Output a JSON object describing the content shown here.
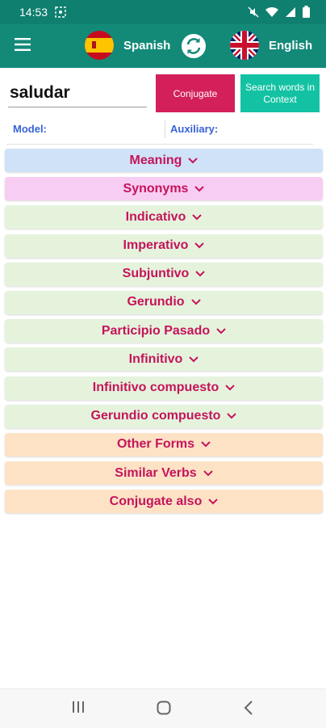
{
  "status": {
    "time": "14:53"
  },
  "appbar": {
    "source_lang": "Spanish",
    "target_lang": "English"
  },
  "search": {
    "value": "saludar"
  },
  "buttons": {
    "conjugate": "Conjugate",
    "search_context_line1": "Search words in",
    "search_context_line2": "Context"
  },
  "info": {
    "model_label": "Model:",
    "auxiliary_label": "Auxiliary:"
  },
  "sections": [
    {
      "label": "Meaning",
      "color": "#cfe2f8"
    },
    {
      "label": "Synonyms",
      "color": "#f8cdf3"
    },
    {
      "label": "Indicativo",
      "color": "#e5f3dd"
    },
    {
      "label": "Imperativo",
      "color": "#e5f3dd"
    },
    {
      "label": "Subjuntivo",
      "color": "#e5f3dd"
    },
    {
      "label": "Gerundio",
      "color": "#e5f3dd"
    },
    {
      "label": "Participio Pasado",
      "color": "#e5f3dd"
    },
    {
      "label": "Infinitivo",
      "color": "#e5f3dd"
    },
    {
      "label": "Infinitivo compuesto",
      "color": "#e5f3dd"
    },
    {
      "label": "Gerundio compuesto",
      "color": "#e5f3dd"
    },
    {
      "label": "Other Forms",
      "color": "#fde2c6"
    },
    {
      "label": "Similar Verbs",
      "color": "#fde2c6"
    },
    {
      "label": "Conjugate also",
      "color": "#fde2c6"
    }
  ],
  "colors": {
    "appbar": "#138a78",
    "conjugate_button": "#d3205a",
    "search_button": "#13c2a3",
    "section_text": "#c5145a",
    "info_text": "#3763d6"
  }
}
